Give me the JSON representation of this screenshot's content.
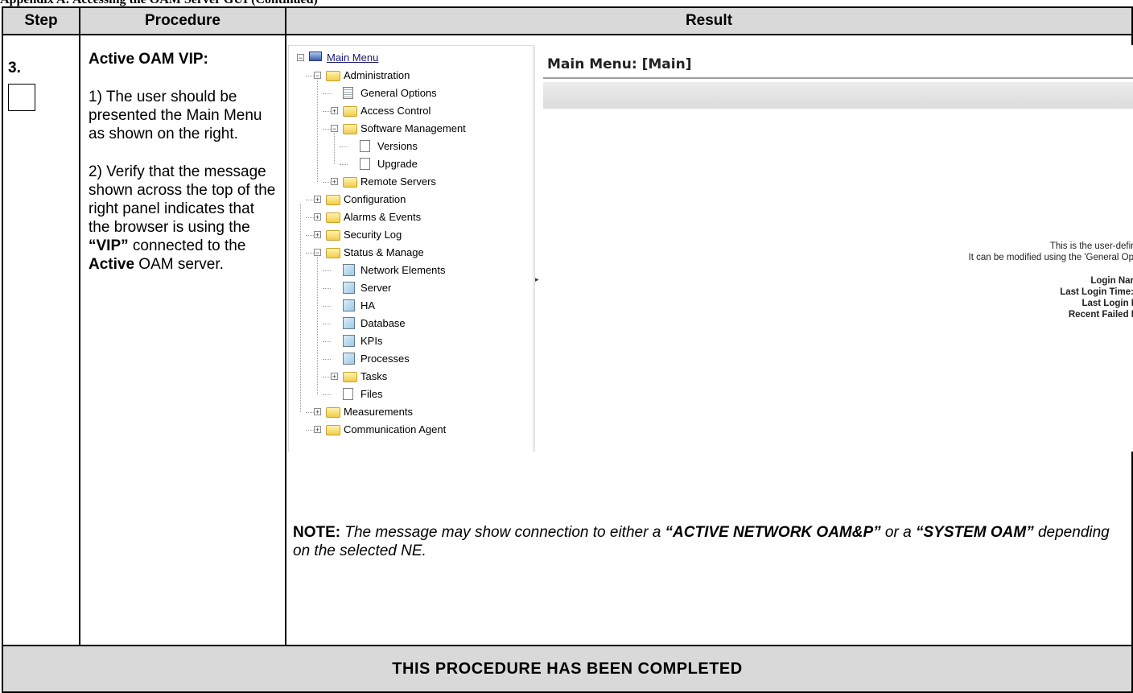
{
  "doc_header": "Appendix A: Accessing the OAM Server GUI (Continued)",
  "table": {
    "headers": [
      "Step",
      "Procedure",
      "Result"
    ],
    "footer": "THIS PROCEDURE HAS BEEN COMPLETED"
  },
  "step": {
    "number": "3.",
    "title": "Active OAM VIP:",
    "p1": "1) The user should be presented the Main Menu as shown on the right.",
    "p2_pre": "2) Verify that the message shown across the top of the right panel indicates that the browser is using the ",
    "p2_vip": "“VIP”",
    "p2_mid": " connected to the ",
    "p2_active": "Active",
    "p2_post": " OAM server."
  },
  "screenshot": {
    "tree": [
      {
        "label": "Main Menu",
        "icon": "monitor",
        "toggle": "minus",
        "level": 0
      },
      {
        "label": "Administration",
        "icon": "folder-open",
        "toggle": "minus",
        "level": 1
      },
      {
        "label": "General Options",
        "icon": "options-doc",
        "toggle": "",
        "level": 2
      },
      {
        "label": "Access Control",
        "icon": "folder",
        "toggle": "plus",
        "level": 2
      },
      {
        "label": "Software Management",
        "icon": "folder-open",
        "toggle": "minus",
        "level": 2
      },
      {
        "label": "Versions",
        "icon": "document",
        "toggle": "",
        "level": 3
      },
      {
        "label": "Upgrade",
        "icon": "document",
        "toggle": "",
        "level": 3
      },
      {
        "label": "Remote Servers",
        "icon": "folder",
        "toggle": "plus",
        "level": 2
      },
      {
        "label": "Configuration",
        "icon": "folder",
        "toggle": "plus",
        "level": 1
      },
      {
        "label": "Alarms & Events",
        "icon": "folder",
        "toggle": "plus",
        "level": 1
      },
      {
        "label": "Security Log",
        "icon": "folder",
        "toggle": "plus",
        "level": 1
      },
      {
        "label": "Status & Manage",
        "icon": "folder-open",
        "toggle": "minus",
        "level": 1
      },
      {
        "label": "Network Elements",
        "icon": "status-doc",
        "toggle": "",
        "level": 2
      },
      {
        "label": "Server",
        "icon": "status-doc",
        "toggle": "",
        "level": 2
      },
      {
        "label": "HA",
        "icon": "status-doc",
        "toggle": "",
        "level": 2
      },
      {
        "label": "Database",
        "icon": "status-doc",
        "toggle": "",
        "level": 2
      },
      {
        "label": "KPIs",
        "icon": "status-doc",
        "toggle": "",
        "level": 2
      },
      {
        "label": "Processes",
        "icon": "status-doc",
        "toggle": "",
        "level": 2
      },
      {
        "label": "Tasks",
        "icon": "folder",
        "toggle": "plus",
        "level": 2
      },
      {
        "label": "Files",
        "icon": "document",
        "toggle": "",
        "level": 2
      },
      {
        "label": "Measurements",
        "icon": "folder",
        "toggle": "plus",
        "level": 1
      },
      {
        "label": "Communication Agent",
        "icon": "folder",
        "toggle": "plus",
        "level": 1
      }
    ],
    "main_title": "Main Menu: [Main]",
    "message_line1": "This is the user-defir",
    "message_line2": "It can be modified using the 'General Op",
    "login_name": "Login Nar",
    "last_login_time": "Last Login Time:",
    "last_login_ip": "Last Login I",
    "recent_failed": "Recent Failed I"
  },
  "note": {
    "label": "NOTE:",
    "t1": " The message may show connection to either a ",
    "q1": "“ACTIVE NETWORK OAM&P”",
    "t2": " or a ",
    "q2": "“SYSTEM OAM”",
    "t3": " depending on the selected NE."
  }
}
